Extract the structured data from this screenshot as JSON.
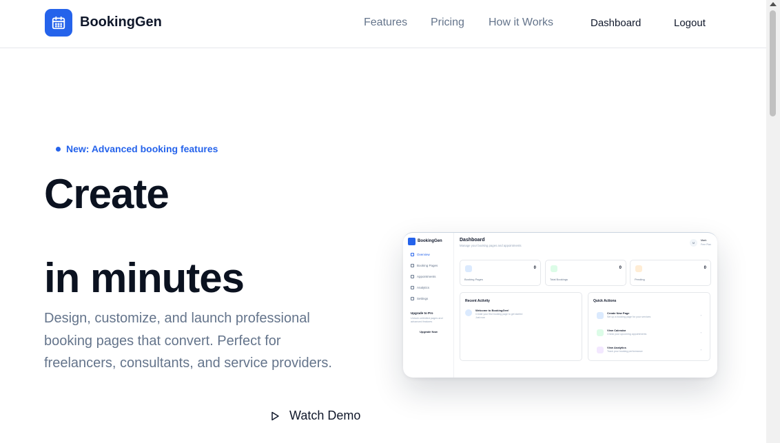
{
  "header": {
    "brand": "BookingGen",
    "nav": [
      "Features",
      "Pricing",
      "How it Works"
    ],
    "dashboard_label": "Dashboard",
    "logout_label": "Logout"
  },
  "hero": {
    "badge": "New: Advanced booking features",
    "title_line1": "Create",
    "title_line2": "in minutes",
    "subtitle": "Design, customize, and launch professional booking pages that convert. Perfect for freelancers, consultants, and service providers.",
    "watch_demo": "Watch Demo"
  },
  "mock": {
    "brand": "BookingGen",
    "sidebar": [
      "Overview",
      "Booking Pages",
      "Appointments",
      "Analytics",
      "Settings"
    ],
    "upgrade_title": "Upgrade to Pro",
    "upgrade_desc": "Unlock unlimited pages and advanced features",
    "upgrade_button": "Upgrade Now",
    "title": "Dashboard",
    "desc": "Manage your booking pages and appointments",
    "avatar": "M",
    "user": "Mark",
    "plan": "Free Plan",
    "stats": [
      {
        "label": "Booking Pages",
        "value": "0",
        "color": "#dbeafe"
      },
      {
        "label": "Total Bookings",
        "value": "0",
        "color": "#dcfce7"
      },
      {
        "label": "Pending",
        "value": "0",
        "color": "#ffedd5"
      }
    ],
    "recent_title": "Recent Activity",
    "activity_title": "Welcome to BookingGen!",
    "activity_desc": "Create your first booking page to get started",
    "activity_time": "Just now",
    "quick_title": "Quick Actions",
    "quick": [
      {
        "title": "Create New Page",
        "desc": "Set up a booking page for your services",
        "color": "#dbeafe"
      },
      {
        "title": "View Calendar",
        "desc": "Check your upcoming appointments",
        "color": "#dcfce7"
      },
      {
        "title": "View Analytics",
        "desc": "Track your booking performance",
        "color": "#f3e8ff"
      }
    ]
  }
}
